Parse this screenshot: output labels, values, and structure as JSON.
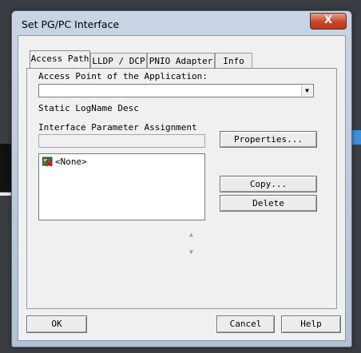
{
  "window": {
    "title": "Set PG/PC Interface",
    "close_glyph": "X"
  },
  "tabs": [
    {
      "label": "Access Path",
      "active": true
    },
    {
      "label": "LLDP / DCP",
      "active": false
    },
    {
      "label": "PNIO Adapter",
      "active": false
    },
    {
      "label": "Info",
      "active": false
    }
  ],
  "access_path": {
    "access_point_label": "Access Point of the Application:",
    "access_point_value": "",
    "static_logname": "Static LogName Desc",
    "interface_param_label": "Interface Parameter Assignment",
    "interface_param_value": "",
    "list_items": [
      {
        "label": "<None>",
        "icon": "network-adapter-icon"
      }
    ],
    "buttons": {
      "properties": "Properties...",
      "copy": "Copy...",
      "delete": "Delete"
    },
    "spin_up": "▲",
    "spin_down": "▼"
  },
  "footer": {
    "ok": "OK",
    "cancel": "Cancel",
    "help": "Help"
  }
}
